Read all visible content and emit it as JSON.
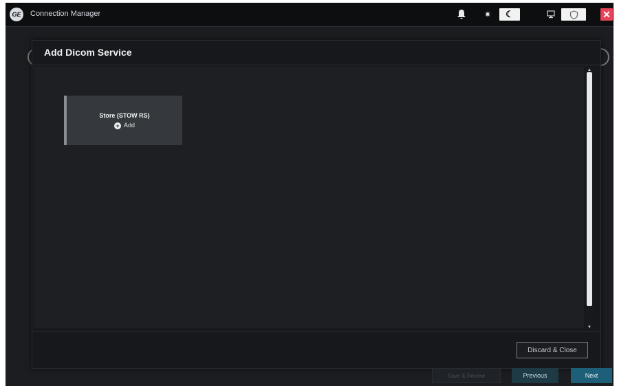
{
  "titlebar": {
    "app_title": "Connection Manager",
    "logo_text": "GE",
    "icons": [
      "bell-icon",
      "sun-icon",
      "moon-icon",
      "monitor-icon",
      "shield-icon",
      "close-icon"
    ],
    "moon_glyph": "☾",
    "sun_glyph": "✷",
    "close_glyph": "✕"
  },
  "modal": {
    "title": "Add Dicom Service",
    "service_card": {
      "name": "Store (STOW RS)",
      "add_label": "Add"
    },
    "discard_label": "Discard & Close"
  },
  "footer": {
    "save_review_label": "Save & Review",
    "previous_label": "Previous",
    "next_label": "Next"
  },
  "colors": {
    "accent": "#1d5f78",
    "close": "#e8435a",
    "background": "#1b1d20"
  }
}
